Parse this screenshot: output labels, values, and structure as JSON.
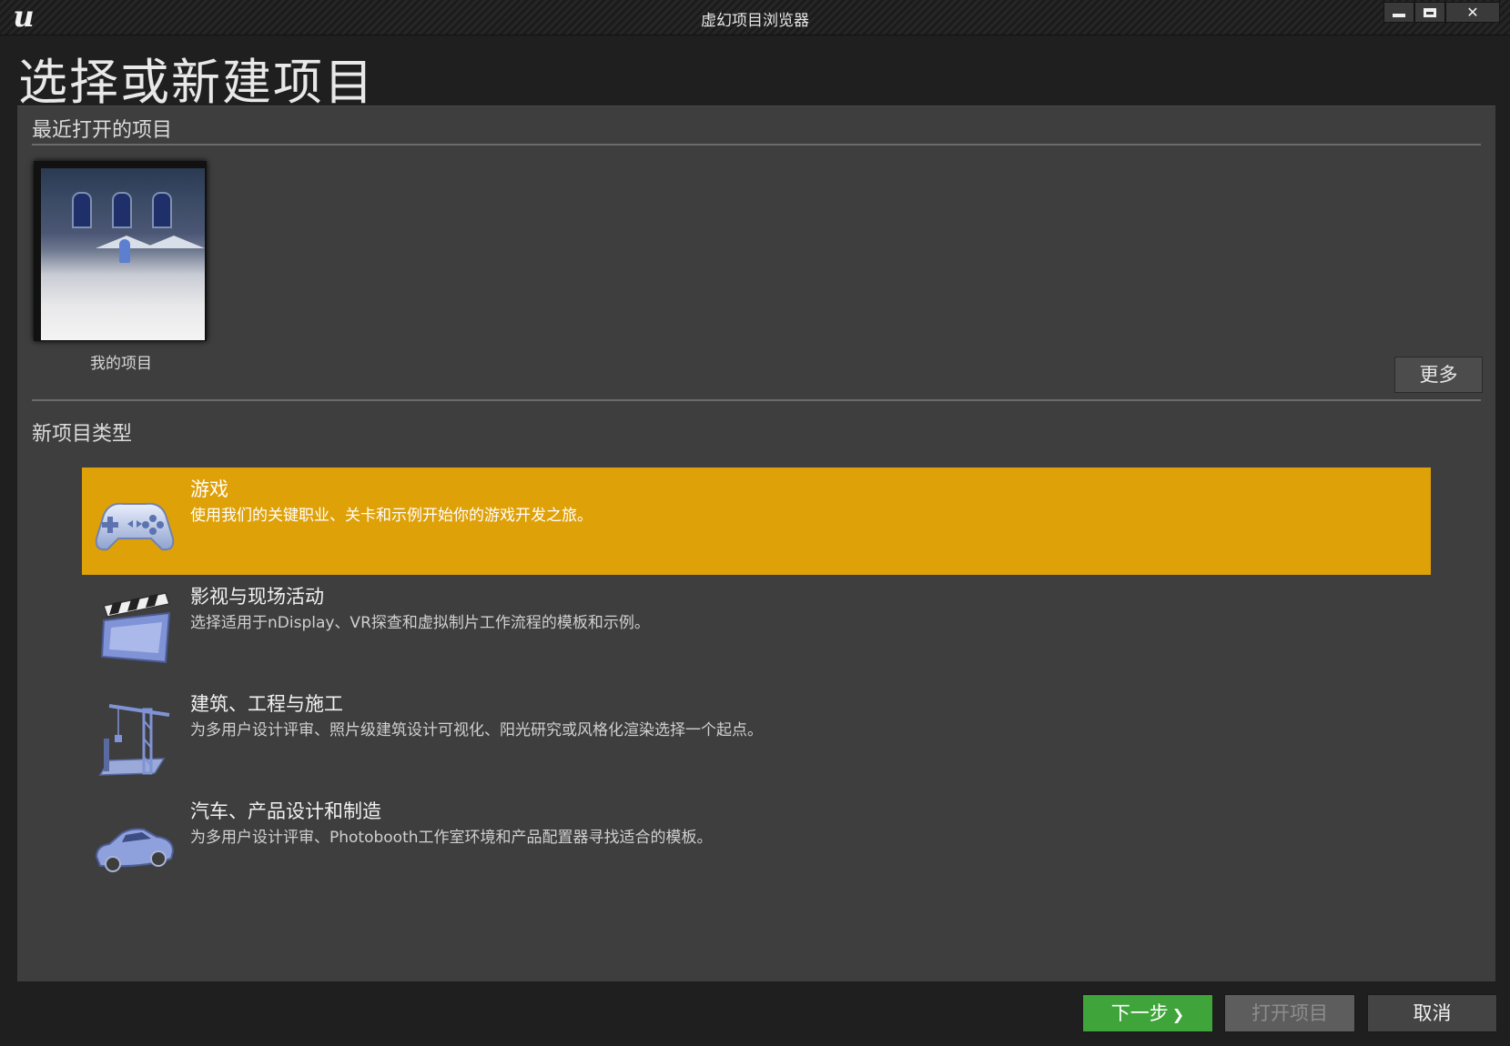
{
  "window": {
    "title": "虚幻项目浏览器",
    "logo_icon": "unreal-logo",
    "buttons": [
      "minimize-icon",
      "maximize-icon",
      "close-icon"
    ]
  },
  "page": {
    "title": "选择或新建项目"
  },
  "recent": {
    "heading": "最近打开的项目",
    "projects": [
      {
        "name": "我的项目",
        "thumbnail": "city-plaza-thumbnail"
      }
    ],
    "more_label": "更多"
  },
  "new_project": {
    "heading": "新项目类型",
    "categories": [
      {
        "title": "游戏",
        "description": "使用我们的关键职业、关卡和示例开始你的游戏开发之旅。",
        "icon": "gamepad-icon",
        "selected": true
      },
      {
        "title": "影视与现场活动",
        "description": "选择适用于nDisplay、VR探查和虚拟制片工作流程的模板和示例。",
        "icon": "clapperboard-icon",
        "selected": false
      },
      {
        "title": "建筑、工程与施工",
        "description": "为多用户设计评审、照片级建筑设计可视化、阳光研究或风格化渲染选择一个起点。",
        "icon": "crane-icon",
        "selected": false
      },
      {
        "title": "汽车、产品设计和制造",
        "description": "为多用户设计评审、Photobooth工作室环境和产品配置器寻找适合的模板。",
        "icon": "car-icon",
        "selected": false
      }
    ]
  },
  "footer": {
    "next_label": "下一步",
    "next_icon": "chevron-right-icon",
    "open_label": "打开项目",
    "cancel_label": "取消"
  },
  "colors": {
    "selected_category": "#dfa108",
    "next_button": "#3fa53a",
    "panel": "#3e3e3e",
    "background": "#1f1f1f"
  }
}
